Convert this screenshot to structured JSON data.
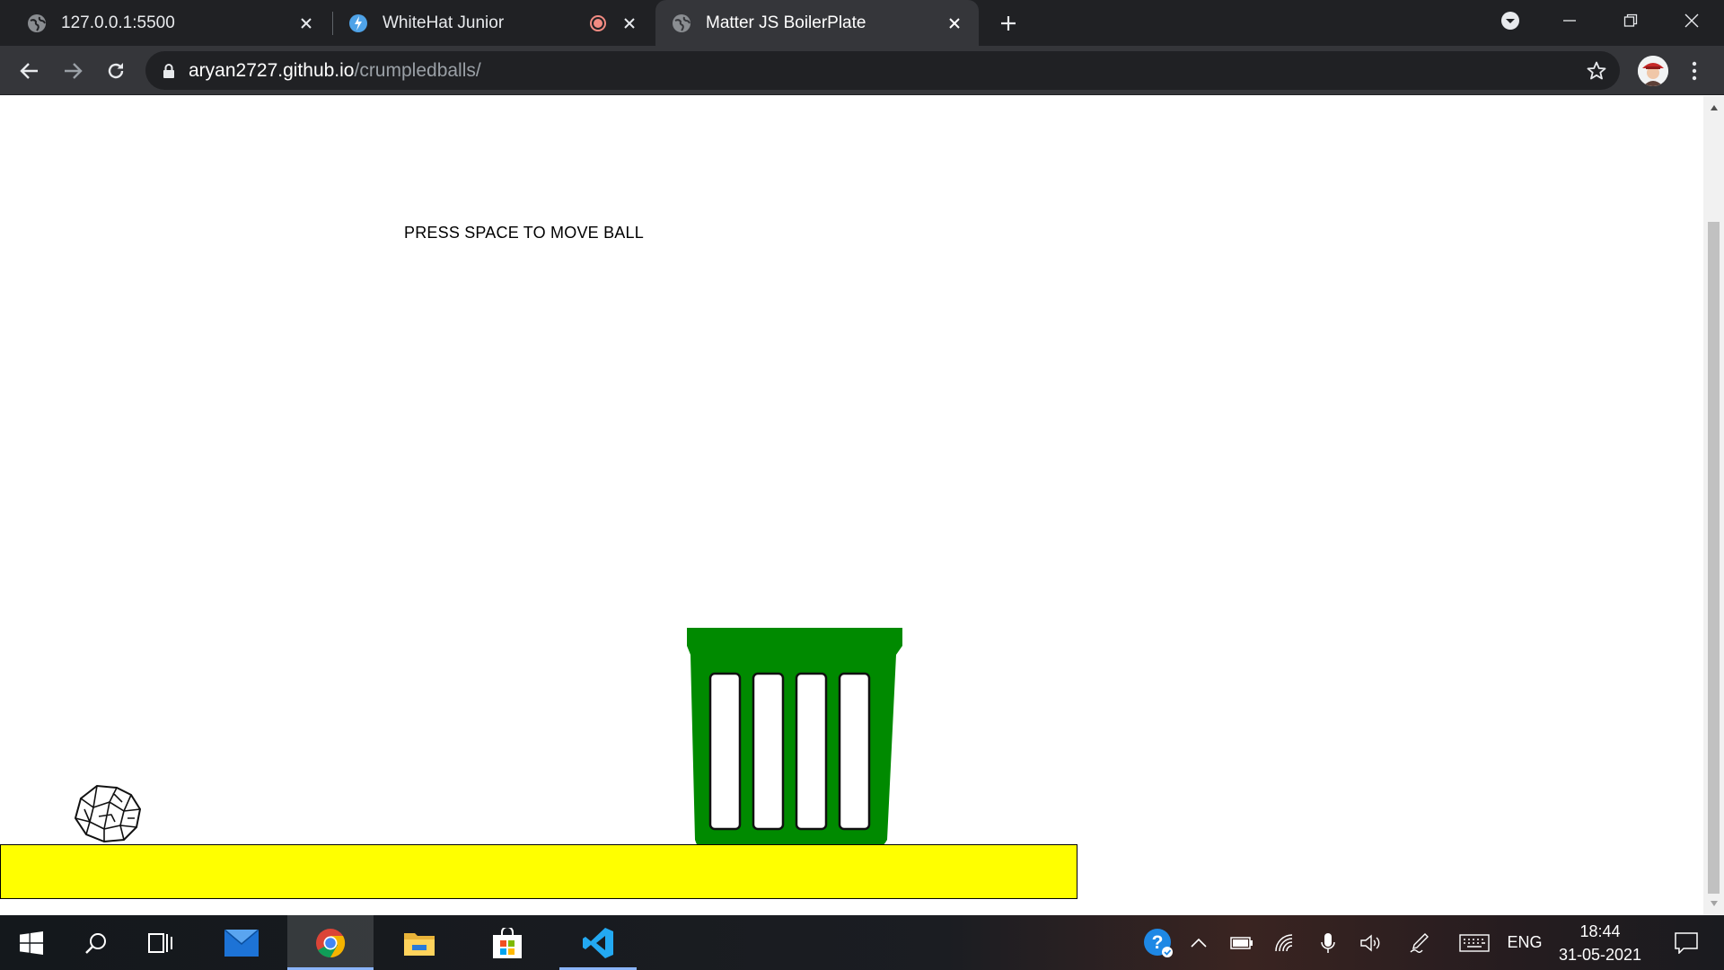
{
  "browser": {
    "tabs": [
      {
        "title": "127.0.0.1:5500",
        "favicon": "globe-icon",
        "active": false
      },
      {
        "title": "WhiteHat Junior",
        "favicon": "whitehat-icon",
        "active": false,
        "recording": true
      },
      {
        "title": "Matter JS BoilerPlate",
        "favicon": "globe-icon",
        "active": true
      }
    ],
    "url": {
      "host": "aryan2727.github.io",
      "path": "/crumpledballs/"
    }
  },
  "page": {
    "instruction": "PRESS SPACE TO MOVE BALL",
    "colors": {
      "ground": "#ffff00",
      "bin": "#008a00",
      "background": "#ffffff"
    }
  },
  "taskbar": {
    "apps": [
      "start-icon",
      "search-icon",
      "task-view-icon",
      "mail-icon",
      "chrome-icon",
      "file-explorer-icon",
      "store-icon",
      "vscode-icon"
    ],
    "active_app": "chrome-icon",
    "language": "ENG",
    "time": "18:44",
    "date": "31-05-2021"
  }
}
